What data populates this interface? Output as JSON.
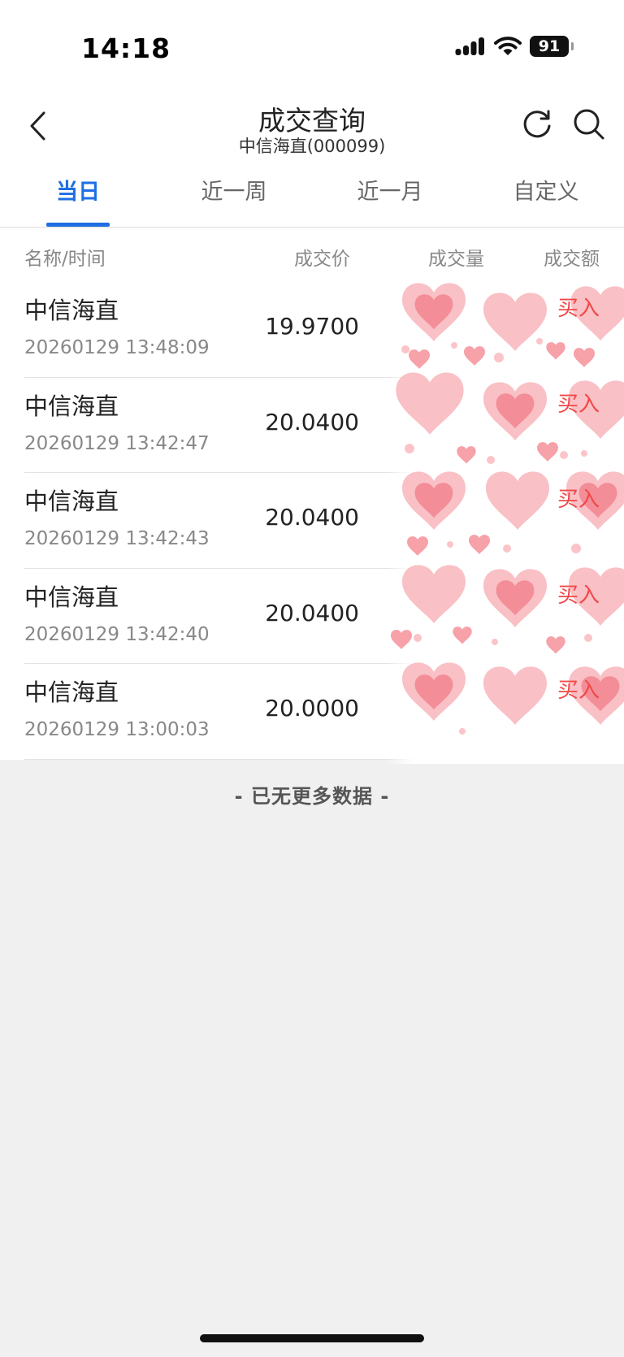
{
  "status_bar": {
    "time": "14:18",
    "battery": "91"
  },
  "header": {
    "title": "成交查询",
    "subtitle": "中信海直(000099)"
  },
  "tabs": [
    {
      "label": "当日",
      "active": true
    },
    {
      "label": "近一周",
      "active": false
    },
    {
      "label": "近一月",
      "active": false
    },
    {
      "label": "自定义",
      "active": false
    }
  ],
  "table": {
    "headers": {
      "name_time": "名称/时间",
      "price": "成交价",
      "volume": "成交量",
      "amount": "成交额"
    },
    "rows": [
      {
        "name": "中信海直",
        "time": "20260129 13:48:09",
        "price": "19.9700",
        "side": "买入"
      },
      {
        "name": "中信海直",
        "time": "20260129 13:42:47",
        "price": "20.0400",
        "side": "买入"
      },
      {
        "name": "中信海直",
        "time": "20260129 13:42:43",
        "price": "20.0400",
        "side": "买入"
      },
      {
        "name": "中信海直",
        "time": "20260129 13:42:40",
        "price": "20.0400",
        "side": "买入"
      },
      {
        "name": "中信海直",
        "time": "20260129 13:00:03",
        "price": "20.0000",
        "side": "买入"
      }
    ]
  },
  "footer": {
    "no_more": "- 已无更多数据 -"
  },
  "colors": {
    "accent": "#1e6fe3",
    "buy": "#f04848",
    "heart": "#f7a1a8"
  }
}
